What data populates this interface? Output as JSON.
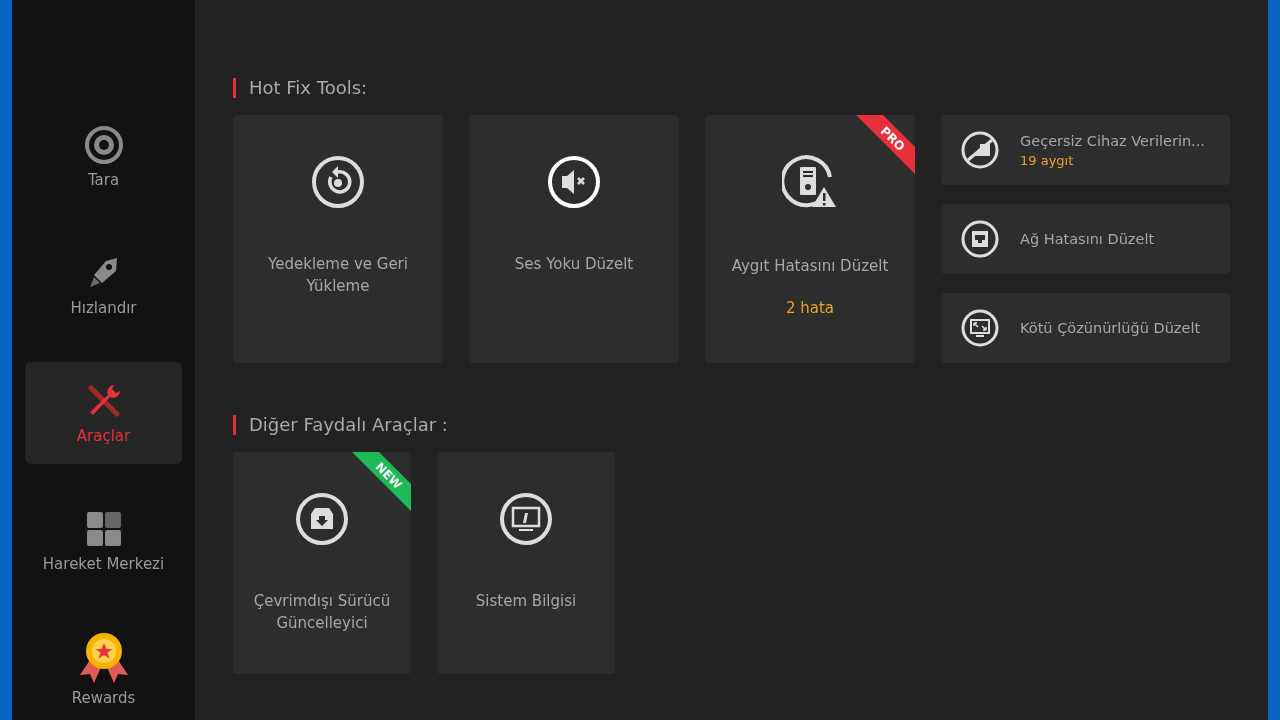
{
  "sidebar": {
    "items": [
      {
        "label": "Tara",
        "selected": false
      },
      {
        "label": "Hızlandır",
        "selected": false
      },
      {
        "label": "Araçlar",
        "selected": true
      },
      {
        "label": "Hareket Merkezi",
        "selected": false
      },
      {
        "label": "Rewards",
        "selected": false
      }
    ]
  },
  "hot_fix": {
    "title": "Hot Fix Tools:",
    "tiles": [
      {
        "title": "Yedekleme ve Geri Yükleme"
      },
      {
        "title": "Ses Yoku Düzelt"
      },
      {
        "title": "Aygıt Hatasını Düzelt",
        "status": "2 hata",
        "badge": {
          "text": "PRO",
          "kind": "pro"
        }
      }
    ],
    "small_tiles": [
      {
        "title": "Geçersiz Cihaz Verilerin...",
        "status": "19 aygıt"
      },
      {
        "title": "Ağ Hatasını Düzelt"
      },
      {
        "title": "Kötü Çözünürlüğü Düzelt"
      }
    ]
  },
  "other_tools": {
    "title": "Diğer Faydalı Araçlar :",
    "tiles": [
      {
        "title": "Çevrimdışı Sürücü Güncelleyici",
        "badge": {
          "text": "NEW",
          "kind": "new"
        }
      },
      {
        "title": "Sistem Bilgisi"
      }
    ]
  }
}
